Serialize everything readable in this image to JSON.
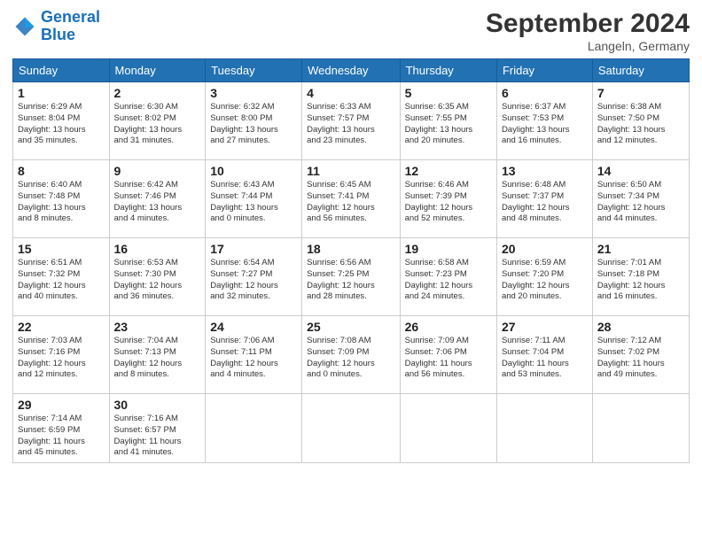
{
  "header": {
    "logo_text_general": "General",
    "logo_text_blue": "Blue",
    "month_title": "September 2024",
    "location": "Langeln, Germany"
  },
  "days_of_week": [
    "Sunday",
    "Monday",
    "Tuesday",
    "Wednesday",
    "Thursday",
    "Friday",
    "Saturday"
  ],
  "weeks": [
    [
      {
        "day": "1",
        "info": "Sunrise: 6:29 AM\nSunset: 8:04 PM\nDaylight: 13 hours\nand 35 minutes."
      },
      {
        "day": "2",
        "info": "Sunrise: 6:30 AM\nSunset: 8:02 PM\nDaylight: 13 hours\nand 31 minutes."
      },
      {
        "day": "3",
        "info": "Sunrise: 6:32 AM\nSunset: 8:00 PM\nDaylight: 13 hours\nand 27 minutes."
      },
      {
        "day": "4",
        "info": "Sunrise: 6:33 AM\nSunset: 7:57 PM\nDaylight: 13 hours\nand 23 minutes."
      },
      {
        "day": "5",
        "info": "Sunrise: 6:35 AM\nSunset: 7:55 PM\nDaylight: 13 hours\nand 20 minutes."
      },
      {
        "day": "6",
        "info": "Sunrise: 6:37 AM\nSunset: 7:53 PM\nDaylight: 13 hours\nand 16 minutes."
      },
      {
        "day": "7",
        "info": "Sunrise: 6:38 AM\nSunset: 7:50 PM\nDaylight: 13 hours\nand 12 minutes."
      }
    ],
    [
      {
        "day": "8",
        "info": "Sunrise: 6:40 AM\nSunset: 7:48 PM\nDaylight: 13 hours\nand 8 minutes."
      },
      {
        "day": "9",
        "info": "Sunrise: 6:42 AM\nSunset: 7:46 PM\nDaylight: 13 hours\nand 4 minutes."
      },
      {
        "day": "10",
        "info": "Sunrise: 6:43 AM\nSunset: 7:44 PM\nDaylight: 13 hours\nand 0 minutes."
      },
      {
        "day": "11",
        "info": "Sunrise: 6:45 AM\nSunset: 7:41 PM\nDaylight: 12 hours\nand 56 minutes."
      },
      {
        "day": "12",
        "info": "Sunrise: 6:46 AM\nSunset: 7:39 PM\nDaylight: 12 hours\nand 52 minutes."
      },
      {
        "day": "13",
        "info": "Sunrise: 6:48 AM\nSunset: 7:37 PM\nDaylight: 12 hours\nand 48 minutes."
      },
      {
        "day": "14",
        "info": "Sunrise: 6:50 AM\nSunset: 7:34 PM\nDaylight: 12 hours\nand 44 minutes."
      }
    ],
    [
      {
        "day": "15",
        "info": "Sunrise: 6:51 AM\nSunset: 7:32 PM\nDaylight: 12 hours\nand 40 minutes."
      },
      {
        "day": "16",
        "info": "Sunrise: 6:53 AM\nSunset: 7:30 PM\nDaylight: 12 hours\nand 36 minutes."
      },
      {
        "day": "17",
        "info": "Sunrise: 6:54 AM\nSunset: 7:27 PM\nDaylight: 12 hours\nand 32 minutes."
      },
      {
        "day": "18",
        "info": "Sunrise: 6:56 AM\nSunset: 7:25 PM\nDaylight: 12 hours\nand 28 minutes."
      },
      {
        "day": "19",
        "info": "Sunrise: 6:58 AM\nSunset: 7:23 PM\nDaylight: 12 hours\nand 24 minutes."
      },
      {
        "day": "20",
        "info": "Sunrise: 6:59 AM\nSunset: 7:20 PM\nDaylight: 12 hours\nand 20 minutes."
      },
      {
        "day": "21",
        "info": "Sunrise: 7:01 AM\nSunset: 7:18 PM\nDaylight: 12 hours\nand 16 minutes."
      }
    ],
    [
      {
        "day": "22",
        "info": "Sunrise: 7:03 AM\nSunset: 7:16 PM\nDaylight: 12 hours\nand 12 minutes."
      },
      {
        "day": "23",
        "info": "Sunrise: 7:04 AM\nSunset: 7:13 PM\nDaylight: 12 hours\nand 8 minutes."
      },
      {
        "day": "24",
        "info": "Sunrise: 7:06 AM\nSunset: 7:11 PM\nDaylight: 12 hours\nand 4 minutes."
      },
      {
        "day": "25",
        "info": "Sunrise: 7:08 AM\nSunset: 7:09 PM\nDaylight: 12 hours\nand 0 minutes."
      },
      {
        "day": "26",
        "info": "Sunrise: 7:09 AM\nSunset: 7:06 PM\nDaylight: 11 hours\nand 56 minutes."
      },
      {
        "day": "27",
        "info": "Sunrise: 7:11 AM\nSunset: 7:04 PM\nDaylight: 11 hours\nand 53 minutes."
      },
      {
        "day": "28",
        "info": "Sunrise: 7:12 AM\nSunset: 7:02 PM\nDaylight: 11 hours\nand 49 minutes."
      }
    ],
    [
      {
        "day": "29",
        "info": "Sunrise: 7:14 AM\nSunset: 6:59 PM\nDaylight: 11 hours\nand 45 minutes."
      },
      {
        "day": "30",
        "info": "Sunrise: 7:16 AM\nSunset: 6:57 PM\nDaylight: 11 hours\nand 41 minutes."
      },
      null,
      null,
      null,
      null,
      null
    ]
  ]
}
